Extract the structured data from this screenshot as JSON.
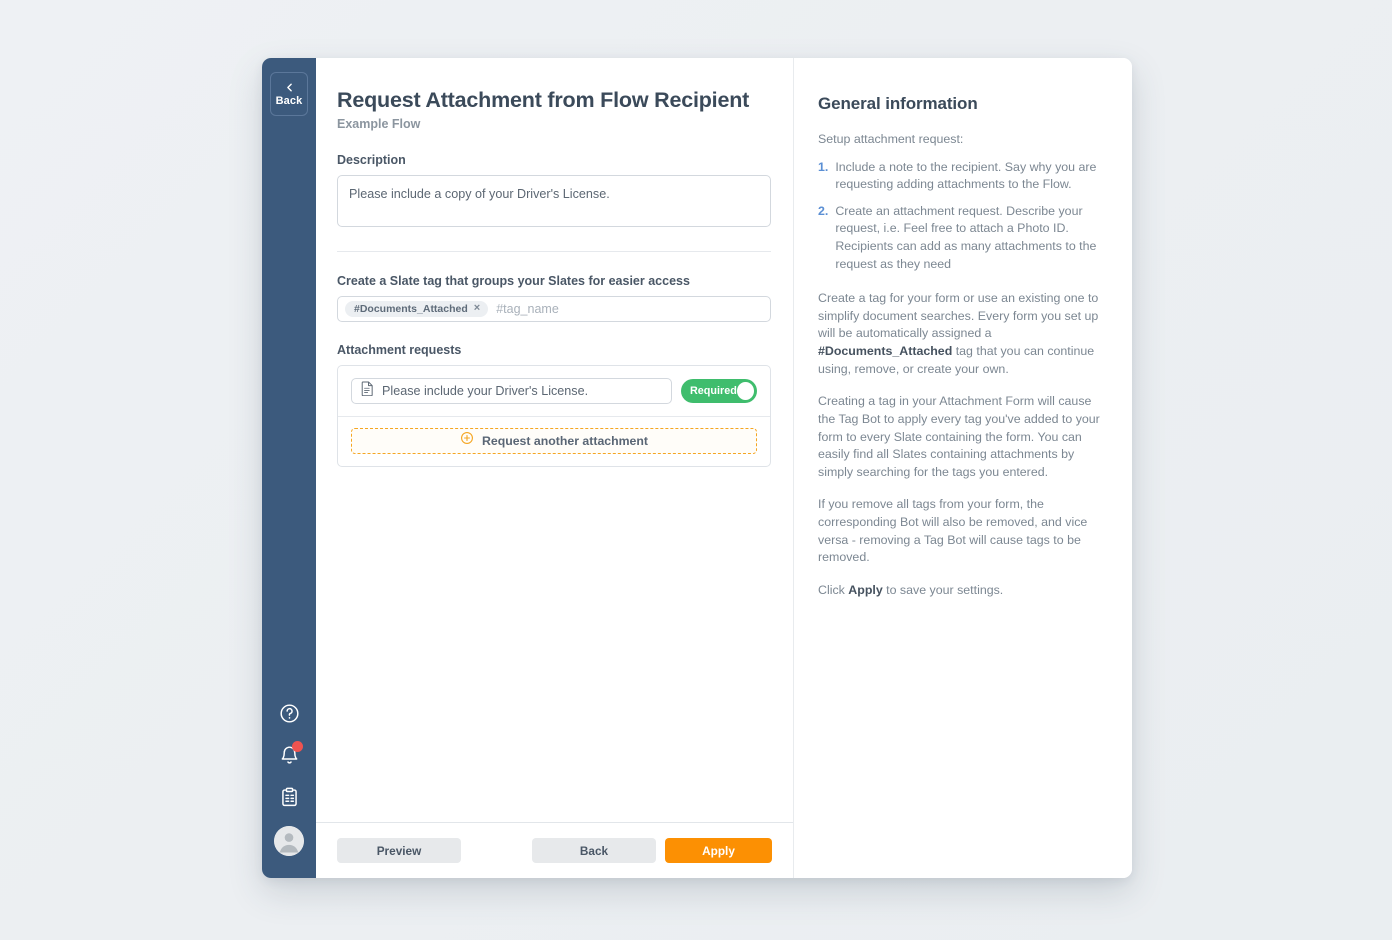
{
  "rail": {
    "back_label": "Back",
    "icons": [
      {
        "name": "help-icon",
        "glyph": "?"
      },
      {
        "name": "bell-icon",
        "has_badge": true
      },
      {
        "name": "clipboard-icon"
      },
      {
        "name": "avatar"
      }
    ]
  },
  "header": {
    "title": "Request Attachment from Flow Recipient",
    "subtitle": "Example Flow"
  },
  "description": {
    "label": "Description",
    "value": "Please include a copy of your Driver's License."
  },
  "tags": {
    "label": "Create a Slate tag that groups your Slates for easier access",
    "chips": [
      {
        "text": "#Documents_Attached",
        "remove": "×"
      }
    ],
    "placeholder": "#tag_name"
  },
  "attachments": {
    "label": "Attachment requests",
    "rows": [
      {
        "icon": "document-icon",
        "value": "Please include your Driver's License.",
        "toggle_label": "Required",
        "toggle_on": true
      }
    ],
    "add_label": "Request another attachment",
    "add_icon": "plus-circle-icon"
  },
  "footer": {
    "preview_label": "Preview",
    "back_label": "Back",
    "apply_label": "Apply"
  },
  "info": {
    "title": "General information",
    "intro": "Setup attachment request:",
    "steps": [
      {
        "num": "1.",
        "text": "Include a note to the recipient. Say why you are requesting adding attachments to the Flow."
      },
      {
        "num": "2.",
        "text": "Create an attachment request. Describe your request, i.e. Feel free to attach a Photo ID. Recipients can add as many attachments to the request as they need"
      }
    ],
    "p1_a": "Create a tag for your form or use an existing one to simplify document searches. Every form you set up will be automatically assigned a ",
    "p1_b": "#Documents_Attached",
    "p1_c": " tag that you can continue using, remove, or create your own.",
    "p2": "Creating a tag in your Attachment Form will cause the Tag Bot to apply every tag you've added to your form to every Slate containing the form. You can easily find all Slates containing attachments by simply searching for the tags you entered.",
    "p3": "If you remove all tags from your form, the corresponding Bot will also be removed, and vice versa - removing a Tag Bot will cause tags to be removed.",
    "p4_a": "Click ",
    "p4_b": "Apply",
    "p4_c": " to save your settings."
  },
  "colors": {
    "rail": "#3c5a7d",
    "accent_orange": "#fc9003",
    "toggle_green": "#3fbd6d",
    "badge_red": "#ef5350",
    "list_number_blue": "#5b8fd4"
  }
}
